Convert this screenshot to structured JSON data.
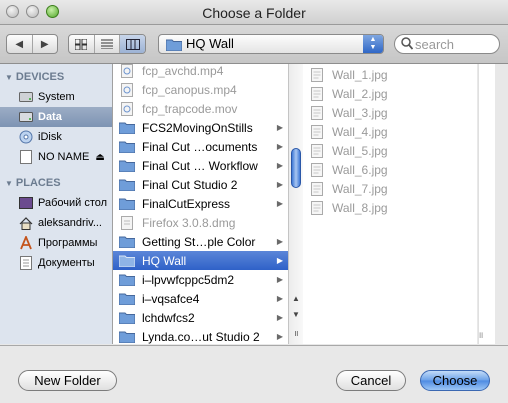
{
  "window": {
    "title": "Choose a Folder"
  },
  "toolbar": {
    "path_popup": "HQ Wall",
    "search_placeholder": "search"
  },
  "sidebar": {
    "devices_header": "DEVICES",
    "places_header": "PLACES",
    "devices": [
      {
        "label": "System",
        "icon": "hard-drive-icon"
      },
      {
        "label": "Data",
        "icon": "hard-drive-icon",
        "selected": true
      },
      {
        "label": "iDisk",
        "icon": "idisk-icon"
      },
      {
        "label": "NO NAME",
        "icon": "external-drive-icon",
        "ejectable": true
      }
    ],
    "places": [
      {
        "label": "Рабочий стол",
        "icon": "desktop-icon"
      },
      {
        "label": "aleksandriv...",
        "icon": "home-icon"
      },
      {
        "label": "Программы",
        "icon": "applications-icon"
      },
      {
        "label": "Документы",
        "icon": "documents-icon"
      }
    ]
  },
  "column1": {
    "items": [
      {
        "label": "fcp_avchd.mp4",
        "kind": "file",
        "dim": true
      },
      {
        "label": "fcp_canopus.mp4",
        "kind": "file",
        "dim": true
      },
      {
        "label": "fcp_trapcode.mov",
        "kind": "file",
        "dim": true
      },
      {
        "label": "FCS2MovingOnStills",
        "kind": "folder"
      },
      {
        "label": "Final Cut …ocuments",
        "kind": "folder"
      },
      {
        "label": "Final Cut … Workflow",
        "kind": "folder"
      },
      {
        "label": "Final Cut Studio 2",
        "kind": "folder"
      },
      {
        "label": "FinalCutExpress",
        "kind": "folder"
      },
      {
        "label": "Firefox 3.0.8.dmg",
        "kind": "file",
        "dim": true
      },
      {
        "label": "Getting St…ple Color",
        "kind": "folder"
      },
      {
        "label": "HQ Wall",
        "kind": "folder",
        "selected": true
      },
      {
        "label": "i–lpvwfcppc5dm2",
        "kind": "folder"
      },
      {
        "label": "i–vqsafce4",
        "kind": "folder"
      },
      {
        "label": "lchdwfcs2",
        "kind": "folder"
      },
      {
        "label": "Lynda.co…ut Studio 2",
        "kind": "folder"
      }
    ]
  },
  "column2": {
    "items": [
      {
        "label": "Wall_1.jpg"
      },
      {
        "label": "Wall_2.jpg"
      },
      {
        "label": "Wall_3.jpg"
      },
      {
        "label": "Wall_4.jpg"
      },
      {
        "label": "Wall_5.jpg"
      },
      {
        "label": "Wall_6.jpg"
      },
      {
        "label": "Wall_7.jpg"
      },
      {
        "label": "Wall_8.jpg"
      }
    ]
  },
  "buttons": {
    "new_folder": "New Folder",
    "cancel": "Cancel",
    "choose": "Choose"
  },
  "colors": {
    "selection": "#3a6dcc",
    "sidebar_bg": "#dde4ee",
    "folder": "#6f9dd9"
  }
}
